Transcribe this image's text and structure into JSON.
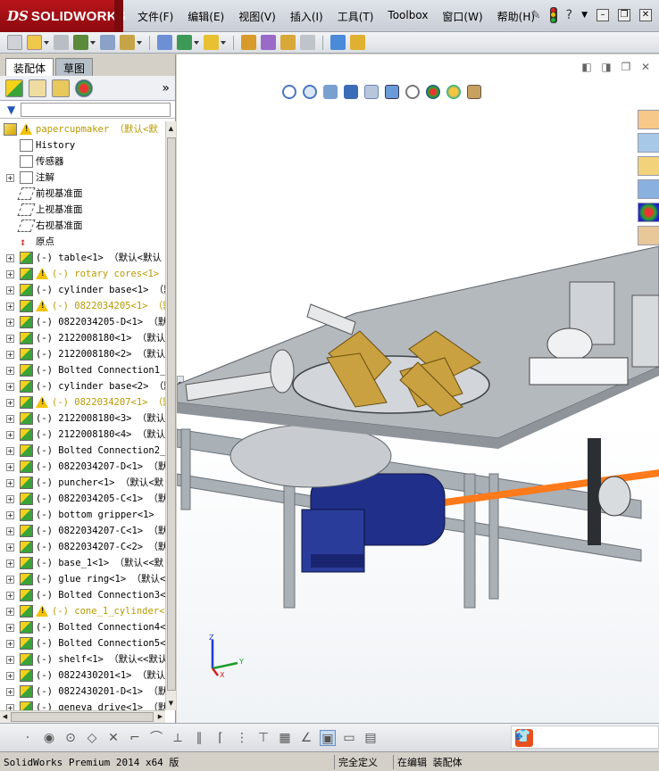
{
  "app": {
    "brand": "SOLIDWORKS",
    "brand_prefix": "DS"
  },
  "menu": [
    "文件(F)",
    "编辑(E)",
    "视图(V)",
    "插入(I)",
    "工具(T)",
    "Toolbox",
    "窗口(W)",
    "帮助(H)"
  ],
  "panel_tabs": {
    "assembly": "装配体",
    "sketch": "草图"
  },
  "tree": [
    {
      "label": "papercupmaker （默认<默",
      "kind": "asm",
      "warn": true,
      "yellow": true,
      "expand": false,
      "level": 0
    },
    {
      "label": "History",
      "kind": "doc",
      "warn": false,
      "yellow": false,
      "expand": false,
      "level": 1
    },
    {
      "label": "传感器",
      "kind": "doc",
      "warn": false,
      "yellow": false,
      "expand": false,
      "level": 1
    },
    {
      "label": "注解",
      "kind": "doc",
      "warn": false,
      "yellow": false,
      "expand": true,
      "level": 1
    },
    {
      "label": "前视基准面",
      "kind": "plane",
      "warn": false,
      "yellow": false,
      "expand": false,
      "level": 1
    },
    {
      "label": "上视基准面",
      "kind": "plane",
      "warn": false,
      "yellow": false,
      "expand": false,
      "level": 1
    },
    {
      "label": "右视基准面",
      "kind": "plane",
      "warn": false,
      "yellow": false,
      "expand": false,
      "level": 1
    },
    {
      "label": "原点",
      "kind": "origin",
      "warn": false,
      "yellow": false,
      "expand": false,
      "level": 1
    },
    {
      "label": "(-) table<1> （默认<默认",
      "kind": "part",
      "warn": false,
      "yellow": false,
      "expand": true,
      "level": 1
    },
    {
      "label": "(-) rotary cores<1>",
      "kind": "part",
      "warn": true,
      "yellow": true,
      "expand": true,
      "level": 1
    },
    {
      "label": "(-) cylinder base<1> （默",
      "kind": "part",
      "warn": false,
      "yellow": false,
      "expand": true,
      "level": 1
    },
    {
      "label": "(-) 0822034205<1> （默",
      "kind": "part",
      "warn": true,
      "yellow": true,
      "expand": true,
      "level": 1
    },
    {
      "label": "(-) 0822034205-D<1> （默",
      "kind": "part",
      "warn": false,
      "yellow": false,
      "expand": true,
      "level": 1
    },
    {
      "label": "(-) 2122008180<1> （默认",
      "kind": "part",
      "warn": false,
      "yellow": false,
      "expand": true,
      "level": 1
    },
    {
      "label": "(-) 2122008180<2> （默认",
      "kind": "part",
      "warn": false,
      "yellow": false,
      "expand": true,
      "level": 1
    },
    {
      "label": "(-) Bolted Connection1_",
      "kind": "part",
      "warn": false,
      "yellow": false,
      "expand": true,
      "level": 1
    },
    {
      "label": "(-) cylinder base<2> （默",
      "kind": "part",
      "warn": false,
      "yellow": false,
      "expand": true,
      "level": 1
    },
    {
      "label": "(-) 0822034207<1> （默",
      "kind": "part",
      "warn": true,
      "yellow": true,
      "expand": true,
      "level": 1
    },
    {
      "label": "(-) 2122008180<3> （默认",
      "kind": "part",
      "warn": false,
      "yellow": false,
      "expand": true,
      "level": 1
    },
    {
      "label": "(-) 2122008180<4> （默认",
      "kind": "part",
      "warn": false,
      "yellow": false,
      "expand": true,
      "level": 1
    },
    {
      "label": "(-) Bolted Connection2_",
      "kind": "part",
      "warn": false,
      "yellow": false,
      "expand": true,
      "level": 1
    },
    {
      "label": "(-) 0822034207-D<1> （默",
      "kind": "part",
      "warn": false,
      "yellow": false,
      "expand": true,
      "level": 1
    },
    {
      "label": "(-) puncher<1> （默认<默",
      "kind": "part",
      "warn": false,
      "yellow": false,
      "expand": true,
      "level": 1
    },
    {
      "label": "(-) 0822034205-C<1> （默",
      "kind": "part",
      "warn": false,
      "yellow": false,
      "expand": true,
      "level": 1
    },
    {
      "label": "(-) bottom gripper<1> （",
      "kind": "part",
      "warn": false,
      "yellow": false,
      "expand": true,
      "level": 1
    },
    {
      "label": "(-) 0822034207-C<1> （默",
      "kind": "part",
      "warn": false,
      "yellow": false,
      "expand": true,
      "level": 1
    },
    {
      "label": "(-) 0822034207-C<2> （默",
      "kind": "part",
      "warn": false,
      "yellow": false,
      "expand": true,
      "level": 1
    },
    {
      "label": "(-) base_1<1> （默认<<默",
      "kind": "part",
      "warn": false,
      "yellow": false,
      "expand": true,
      "level": 1
    },
    {
      "label": "(-) glue ring<1> （默认<",
      "kind": "part",
      "warn": false,
      "yellow": false,
      "expand": true,
      "level": 1
    },
    {
      "label": "(-) Bolted Connection3<",
      "kind": "part",
      "warn": false,
      "yellow": false,
      "expand": true,
      "level": 1
    },
    {
      "label": "(-) cone_1_cylinder<",
      "kind": "part",
      "warn": true,
      "yellow": true,
      "expand": true,
      "level": 1
    },
    {
      "label": "(-) Bolted Connection4<",
      "kind": "part",
      "warn": false,
      "yellow": false,
      "expand": true,
      "level": 1
    },
    {
      "label": "(-) Bolted Connection5<",
      "kind": "part",
      "warn": false,
      "yellow": false,
      "expand": true,
      "level": 1
    },
    {
      "label": "(-) shelf<1> （默认<<默认",
      "kind": "part",
      "warn": false,
      "yellow": false,
      "expand": true,
      "level": 1
    },
    {
      "label": "(-) 0822430201<1> （默认",
      "kind": "part",
      "warn": false,
      "yellow": false,
      "expand": true,
      "level": 1
    },
    {
      "label": "(-) 0822430201-D<1> （默",
      "kind": "part",
      "warn": false,
      "yellow": false,
      "expand": true,
      "level": 1
    },
    {
      "label": "(-) geneva drive<1> （默",
      "kind": "part",
      "warn": false,
      "yellow": false,
      "expand": true,
      "level": 1
    }
  ],
  "triad": {
    "x": "X",
    "y": "Y",
    "z": "Z"
  },
  "status": {
    "product": "SolidWorks Premium 2014 x64 版",
    "definition": "完全定义",
    "mode": "在编辑 装配体"
  },
  "ime": {
    "lang": "中"
  },
  "colors": {
    "brand_red": "#b8151b",
    "warning_yellow": "#f2c200",
    "accent_orange": "#ff7a1a",
    "motor_blue": "#1f2f8a",
    "cone_gold": "#c9a140"
  }
}
